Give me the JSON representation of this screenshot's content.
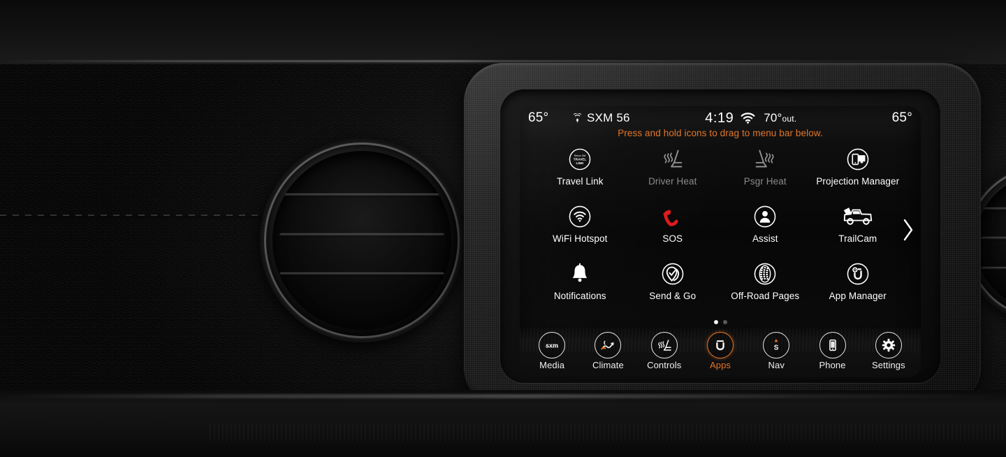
{
  "vehicle": {
    "dashboard": "jeep-dashboard",
    "vents": [
      "center-left-air-vent",
      "right-air-vent"
    ]
  },
  "screen": {
    "status_bar": {
      "left_temp": "65°",
      "radio_icon": "satellite-radio-icon",
      "radio_source": "SXM 56",
      "clock": "4:19",
      "wifi_icon": "wifi-icon",
      "outside_temp": "70°",
      "outside_suffix": "out.",
      "right_temp": "65°"
    },
    "hint": "Press and hold icons to drag to menu bar below.",
    "hint_color": "#e3762a",
    "accent_color": "#e3762a",
    "sos_color": "#e01b1b",
    "apps": [
      {
        "label": "Travel Link",
        "icon": "siriusxm-travel-link-icon",
        "disabled": false
      },
      {
        "label": "Driver Heat",
        "icon": "heated-seat-driver-icon",
        "disabled": true
      },
      {
        "label": "Psgr Heat",
        "icon": "heated-seat-passenger-icon",
        "disabled": true
      },
      {
        "label": "Projection Manager",
        "icon": "projection-manager-icon",
        "disabled": false
      },
      {
        "label": "WiFi Hotspot",
        "icon": "wifi-hotspot-icon",
        "disabled": false
      },
      {
        "label": "SOS",
        "icon": "sos-phone-handset-icon",
        "disabled": false
      },
      {
        "label": "Assist",
        "icon": "assist-person-icon",
        "disabled": false
      },
      {
        "label": "TrailCam",
        "icon": "trailcam-truck-icon",
        "disabled": false
      },
      {
        "label": "Notifications",
        "icon": "bell-icon",
        "disabled": false
      },
      {
        "label": "Send & Go",
        "icon": "send-and-go-pin-icon",
        "disabled": false
      },
      {
        "label": "Off-Road Pages",
        "icon": "tire-tread-icon",
        "disabled": false
      },
      {
        "label": "App Manager",
        "icon": "app-manager-uconnect-gear-icon",
        "disabled": false
      }
    ],
    "next_page_icon": "chevron-right-icon",
    "pagination": {
      "total": 2,
      "active_index": 0
    },
    "menu_bar": [
      {
        "label": "Media",
        "icon": "sxm-logo-icon",
        "active": false
      },
      {
        "label": "Climate",
        "icon": "climate-airflow-icon",
        "active": false
      },
      {
        "label": "Controls",
        "icon": "controls-seat-icon",
        "active": false
      },
      {
        "label": "Apps",
        "icon": "uconnect-u-icon",
        "active": true
      },
      {
        "label": "Nav",
        "icon": "compass-icon",
        "active": false
      },
      {
        "label": "Phone",
        "icon": "smartphone-icon",
        "active": false
      },
      {
        "label": "Settings",
        "icon": "gear-icon",
        "active": false
      }
    ],
    "travel_link_logo": {
      "line1": "Sirius XM",
      "line2": "TRAVEL",
      "line3": "LINK"
    }
  }
}
